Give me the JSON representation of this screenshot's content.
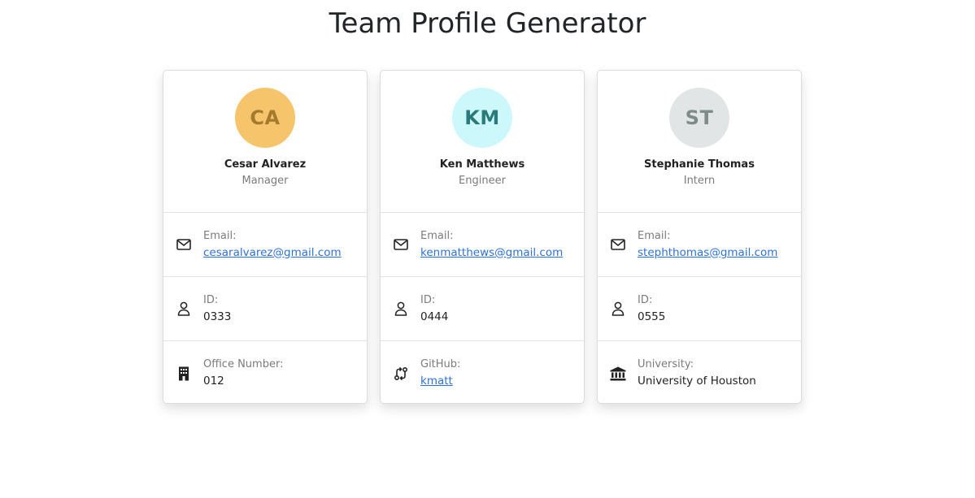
{
  "page": {
    "title": "Team Profile Generator"
  },
  "cards": [
    {
      "initials": "CA",
      "name": "Cesar Alvarez",
      "role": "Manager",
      "avatar_bg": "#f6c46b",
      "avatar_fg": "#a57a2e",
      "email_label": "Email:",
      "email": "cesaralvarez@gmail.com",
      "id_label": "ID:",
      "id": "0333",
      "extra_label": "Office Number:",
      "extra_value": "012",
      "extra_icon": "building-icon"
    },
    {
      "initials": "KM",
      "name": "Ken Matthews",
      "role": "Engineer",
      "avatar_bg": "#ccf7fb",
      "avatar_fg": "#2a7a7a",
      "email_label": "Email:",
      "email": "kenmatthews@gmail.com",
      "id_label": "ID:",
      "id": "0444",
      "extra_label": "GitHub:",
      "extra_value": "kmatt",
      "extra_icon": "git-pull-request-icon"
    },
    {
      "initials": "ST",
      "name": "Stephanie Thomas",
      "role": "Intern",
      "avatar_bg": "#e2e5e6",
      "avatar_fg": "#7f8a8b",
      "email_label": "Email:",
      "email": "stephthomas@gmail.com",
      "id_label": "ID:",
      "id": "0555",
      "extra_label": "University:",
      "extra_value": "University of Houston",
      "extra_icon": "university-icon"
    }
  ],
  "colors": {
    "link": "#2d72d9",
    "muted_text": "#7b7b7b",
    "border": "#e3e3e3"
  }
}
